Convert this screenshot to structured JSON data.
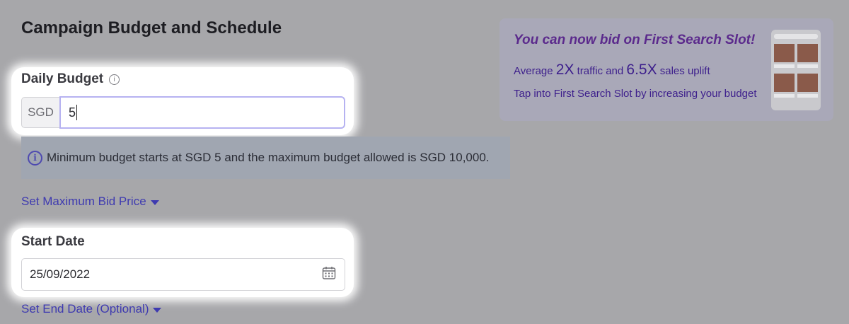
{
  "page": {
    "title": "Campaign Budget and Schedule"
  },
  "daily_budget": {
    "label": "Daily Budget",
    "info_icon": "info-icon",
    "currency": "SGD",
    "value": "5"
  },
  "notice": {
    "icon": "info-icon",
    "text": "Minimum budget starts at SGD 5 and the maximum budget allowed is SGD 10,000."
  },
  "max_bid_link": {
    "label": "Set Maximum Bid Price",
    "icon": "caret-down-icon"
  },
  "start_date": {
    "label": "Start Date",
    "value": "25/09/2022",
    "icon": "calendar-icon"
  },
  "end_date_link": {
    "label": "Set End Date (Optional)",
    "icon": "caret-down-icon"
  },
  "promo": {
    "heading": "You can now bid on First Search Slot!",
    "line1_prefix": "Average ",
    "line1_traffic": "2X",
    "line1_mid": " traffic and ",
    "line1_sales": "6.5X",
    "line1_suffix": " sales uplift",
    "line2": "Tap into First Search Slot by increasing your budget"
  },
  "colors": {
    "link": "#3e3ab0",
    "promo_heading": "#5b2a8c",
    "input_focus_border": "#b6b2f1"
  }
}
